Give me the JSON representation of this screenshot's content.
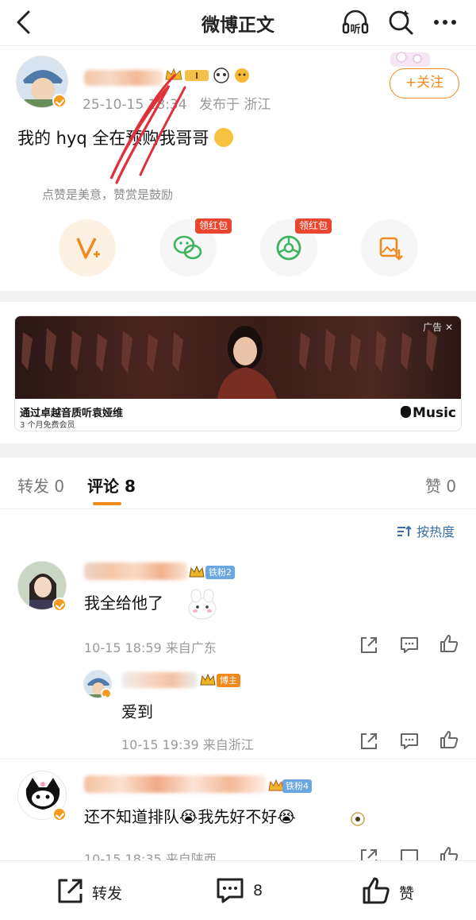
{
  "header": {
    "title": "微博正文",
    "listen_label": "听"
  },
  "post": {
    "time": "25-10-15 18:34",
    "location": "发布于 浙江",
    "text": "我的 hyq 全在预购我哥哥",
    "follow_label": "+关注",
    "reward_hint": "点赞是美意，赞赏是鼓励",
    "actions": [
      {
        "icon": "v-plus-icon",
        "tag": ""
      },
      {
        "icon": "wechat-icon",
        "tag": "领红包"
      },
      {
        "icon": "moments-icon",
        "tag": "领红包"
      },
      {
        "icon": "save-image-icon",
        "tag": ""
      }
    ],
    "badge_label": "I"
  },
  "ad": {
    "label": "广告",
    "title": "通过卓越音质听袁娅维",
    "subtitle": "3 个月免费会员",
    "brand": "Music"
  },
  "tabs": [
    {
      "label": "转发",
      "count": "0"
    },
    {
      "label": "评论",
      "count": "8"
    },
    {
      "label": "赞",
      "count": "0"
    }
  ],
  "sort_label": "按热度",
  "comments": [
    {
      "text": "我全给他了",
      "meta": "10-15 18:59 来自广东",
      "fan_badge": "铁粉2",
      "reply": {
        "text": "爱到",
        "meta": "10-15 19:39 来自浙江",
        "badge": "博主"
      }
    },
    {
      "text": "还不知道排队😭我先好不好😭",
      "meta": "10-15 18:35 来自陕西",
      "fan_badge": "铁粉4"
    }
  ],
  "bottom_bar": {
    "repost_label": "转发",
    "comment_count": "8",
    "like_label": "赞"
  },
  "colors": {
    "accent": "#f08a1c",
    "link": "#3a6ea5",
    "red_tag": "#e8462e"
  }
}
